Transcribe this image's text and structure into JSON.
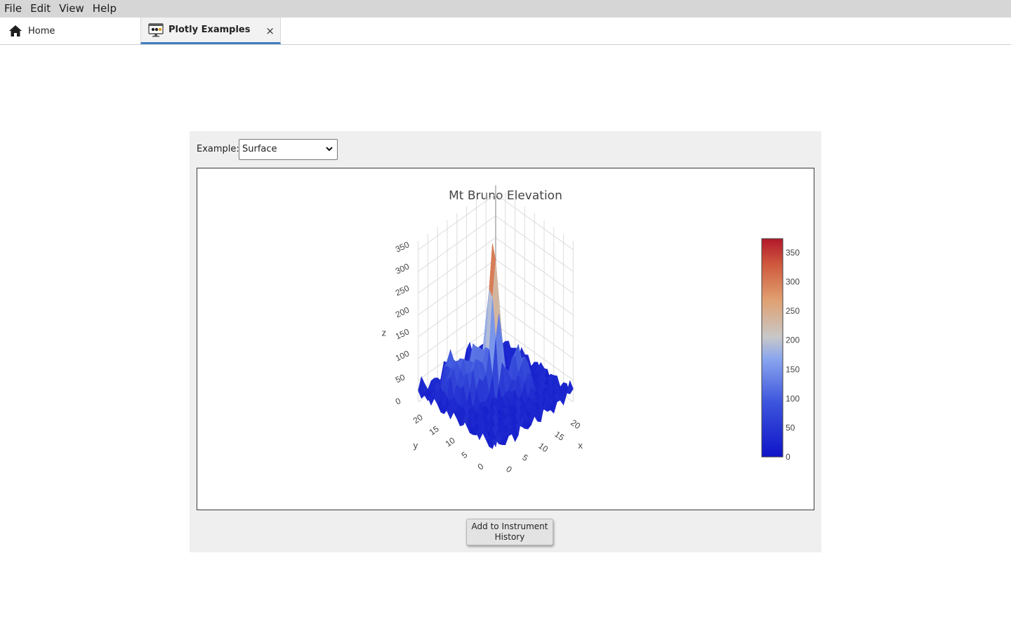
{
  "menubar": {
    "items": [
      "File",
      "Edit",
      "View",
      "Help"
    ]
  },
  "tabs": {
    "home_label": "Home",
    "active_label": "Plotly Examples",
    "close_glyph": "×"
  },
  "panel": {
    "example_label": "Example:",
    "example_value": "Surface",
    "add_button_label": "Add to Instrument History"
  },
  "colors": {
    "accent": "#3f7fc1",
    "colorscale_low": "#0f14c8",
    "colorscale_mid": "#c8c8c8",
    "colorscale_high": "#b2182b"
  },
  "chart_data": {
    "type": "surface",
    "title": "Mt Bruno Elevation",
    "scene": {
      "x_label": "x",
      "y_label": "y",
      "z_label": "z",
      "x_ticks": [
        "0",
        "5",
        "10",
        "15",
        "20"
      ],
      "y_ticks": [
        "0",
        "5",
        "10",
        "15",
        "20"
      ],
      "z_ticks": [
        "0",
        "50",
        "100",
        "150",
        "200",
        "250",
        "300",
        "350"
      ],
      "x_range": [
        0,
        24
      ],
      "y_range": [
        0,
        24
      ],
      "z_range": [
        0,
        370
      ]
    },
    "colorbar": {
      "ticks": [
        "0",
        "50",
        "100",
        "150",
        "200",
        "250",
        "300",
        "350"
      ],
      "tick_values": [
        0,
        50,
        100,
        150,
        200,
        250,
        300,
        350
      ],
      "range": [
        0,
        374
      ]
    },
    "peak_z": 370
  }
}
